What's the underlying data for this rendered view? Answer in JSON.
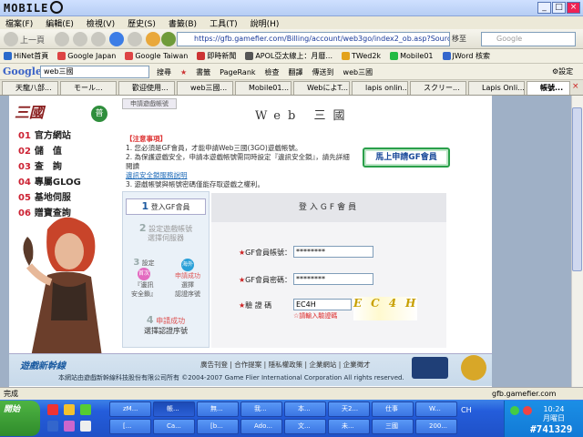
{
  "window": {
    "logo_text": "MOBILE",
    "min": "_",
    "max": "□",
    "close": "×"
  },
  "menu": [
    "檔案(F)",
    "編輯(E)",
    "檢視(V)",
    "歷史(S)",
    "書籤(B)",
    "工具(T)",
    "說明(H)"
  ],
  "nav": {
    "back": "上一頁",
    "address": "https://gfb.gamefier.com/Billing/account/web3go/index2_ob.asp?Sourceid=2&Game=3GO",
    "go": "移至",
    "search_placeholder": "Google"
  },
  "bookmarks": [
    {
      "label": "HiNet首頁",
      "color": "#2a6acb"
    },
    {
      "label": "Google Japan",
      "color": "#d44"
    },
    {
      "label": "Google Taiwan",
      "color": "#d44"
    },
    {
      "label": "即時新聞",
      "color": "#c33"
    },
    {
      "label": "APOL亞太線上：月曆...",
      "color": "#555"
    },
    {
      "label": "TWed2k",
      "color": "#e3a21b"
    },
    {
      "label": "Mobile01",
      "color": "#2b4"
    },
    {
      "label": "JWord 核索",
      "color": "#36c"
    }
  ],
  "gtoolbar": {
    "logo": "Google",
    "query": "web三國",
    "items": [
      "搜尋",
      "書籤",
      "PageRank",
      "檢查",
      "翻譯",
      "傳送到",
      "web三國"
    ],
    "settings": "設定"
  },
  "tabs": [
    {
      "label": "天龍八部..."
    },
    {
      "label": "モール..."
    },
    {
      "label": "歡迎使用..."
    },
    {
      "label": "web三國..."
    },
    {
      "label": "Mobile01..."
    },
    {
      "label": "WebによT..."
    },
    {
      "label": "lapis onlin..."
    },
    {
      "label": "スクリー..."
    },
    {
      "label": "Lapis Onli..."
    },
    {
      "label": "帳號..."
    }
  ],
  "sidebar": {
    "logo": "三國",
    "badge": "普",
    "items": [
      {
        "num": "01",
        "label": "官方網站"
      },
      {
        "num": "02",
        "label": "儲　值"
      },
      {
        "num": "03",
        "label": "查　詢"
      },
      {
        "num": "04",
        "label": "專屬GLOG"
      },
      {
        "num": "05",
        "label": "基地伺服"
      },
      {
        "num": "06",
        "label": "贈寶查詢"
      }
    ]
  },
  "main": {
    "crumb": "申請遊戲帳號",
    "title": "Web 三國",
    "notice_head": "【注意事項】",
    "notice_lines": [
      "1. 您必須是GF會員，才能申請Web三國(3GO)遊戲帳號。",
      "2. 為保護遊戲安全，申請本遊戲帳號需同時設定『邊訊安全鎖』，請先詳細閱讀",
      "3. 遊戲帳號與帳號密碼僅能存取遊戲之權利。"
    ],
    "notice_link": "邊訊安全鎖服務說明",
    "gf_button": "馬上申請GF會員"
  },
  "steps": {
    "s1_num": "1",
    "s1": "登入GF會員",
    "s2_num": "2",
    "s2a": "設定遊戲帳號",
    "s2b": "選擇伺服器",
    "s3_num": "3",
    "s3a_top": "設定",
    "s3a_circle": "首次",
    "s3a_line1": "『邊訊",
    "s3a_line2": "安全鎖』",
    "s3b_circle": "海外",
    "s3b_line1": "申請成功",
    "s3b_line2": "選擇",
    "s3b_line3": "認證序號",
    "s4_num": "4",
    "s4a": "申請成功",
    "s4b": "選擇認證序號"
  },
  "form": {
    "head": "登入GF會員",
    "account_label": "GF會員帳號：",
    "account_value": "********",
    "password_label": "GF會員密碼：",
    "password_value": "********",
    "captcha_label": "驗 證 碼",
    "captcha_value": "EC4H",
    "captcha_image": "EC4H",
    "captcha_hint": "☆請輸入驗證碼"
  },
  "footer": {
    "logo": "遊戲新幹線",
    "links": "廣告刊登 | 合作提案 | 隱私權政策 | 企業網站 | 企業徵才",
    "copyright": "本網站由遊戲新幹線科技股份有限公司所有 ©2004-2007 Game Flier International Corporation All rights reserved."
  },
  "status": {
    "left": "完成",
    "right": "gfb.gamefier.com"
  },
  "taskbar": {
    "start": "開始",
    "row1": [
      "zM...",
      "帳...",
      "無...",
      "我...",
      "本...",
      "天2...",
      "仕事",
      "W..."
    ],
    "row2": [
      "[...",
      "Ca...",
      "[b...",
      "Ado...",
      "文...",
      "未...",
      "三國",
      "200..."
    ],
    "lang": "CH",
    "time": "10:24",
    "day": "月曜日",
    "watermark": "#741329"
  }
}
